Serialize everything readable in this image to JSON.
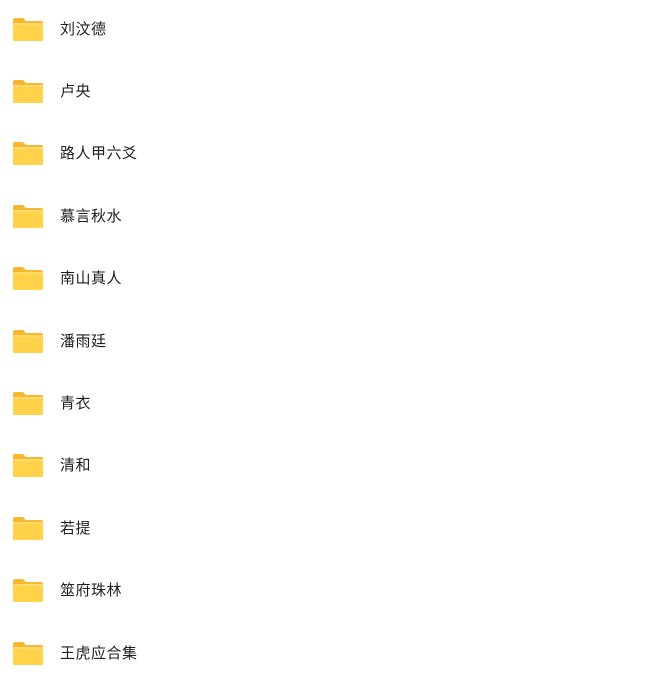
{
  "colors": {
    "folder_back": "#F7B731",
    "folder_front": "#FFD24A",
    "folder_front_top": "#FFDB6E",
    "text": "#1f1f1f"
  },
  "folders": [
    {
      "name": "刘汶德",
      "icon": "folder-icon"
    },
    {
      "name": "卢央",
      "icon": "folder-icon"
    },
    {
      "name": "路人甲六爻",
      "icon": "folder-icon"
    },
    {
      "name": "慕言秋水",
      "icon": "folder-icon"
    },
    {
      "name": "南山真人",
      "icon": "folder-icon"
    },
    {
      "name": "潘雨廷",
      "icon": "folder-icon"
    },
    {
      "name": "青衣",
      "icon": "folder-icon"
    },
    {
      "name": "清和",
      "icon": "folder-icon"
    },
    {
      "name": "若提",
      "icon": "folder-icon"
    },
    {
      "name": "筮府珠林",
      "icon": "folder-icon"
    },
    {
      "name": "王虎应合集",
      "icon": "folder-icon"
    }
  ]
}
